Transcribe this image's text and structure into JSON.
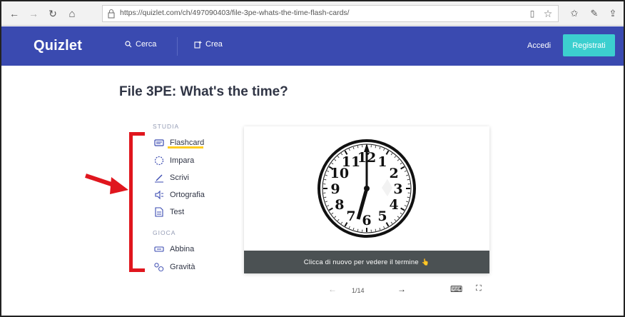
{
  "browser": {
    "url": "https://quizlet.com/ch/497090403/file-3pe-whats-the-time-flash-cards/",
    "back_icon": "←",
    "forward_icon": "→",
    "refresh_icon": "↻",
    "home_icon": "⌂",
    "reading_icon": "▯",
    "favorite_icon": "☆",
    "favorites_bar_icon": "✩",
    "pen_icon": "✎",
    "share_icon": "⇪"
  },
  "header": {
    "logo": "Quizlet",
    "search_label": "Cerca",
    "create_label": "Crea",
    "login_label": "Accedi",
    "signup_label": "Registrati",
    "brand_color": "#3a4ab0",
    "signup_color": "#3ccfcf"
  },
  "set": {
    "title": "File 3PE: What's the time?"
  },
  "study": {
    "section_label": "STUDIA",
    "modes": [
      {
        "label": "Flashcard",
        "icon": "flashcard-icon"
      },
      {
        "label": "Impara",
        "icon": "learn-icon"
      },
      {
        "label": "Scrivi",
        "icon": "write-icon"
      },
      {
        "label": "Ortografia",
        "icon": "spell-icon"
      },
      {
        "label": "Test",
        "icon": "test-icon"
      }
    ]
  },
  "play": {
    "section_label": "GIOCA",
    "modes": [
      {
        "label": "Abbina",
        "icon": "match-icon"
      },
      {
        "label": "Gravità",
        "icon": "gravity-icon"
      }
    ]
  },
  "card": {
    "footer_text": "Clicca di nuovo per vedere il termine",
    "footer_emoji": "👆",
    "clock_numbers": [
      "12",
      "1",
      "2",
      "3",
      "4",
      "5",
      "6",
      "7",
      "8",
      "9",
      "10",
      "11"
    ]
  },
  "pager": {
    "prev_icon": "←",
    "next_icon": "→",
    "position": "1/14",
    "keyboard_icon": "⌨",
    "fullscreen_icon": "⛶"
  },
  "annotation_color": "#e0161e"
}
